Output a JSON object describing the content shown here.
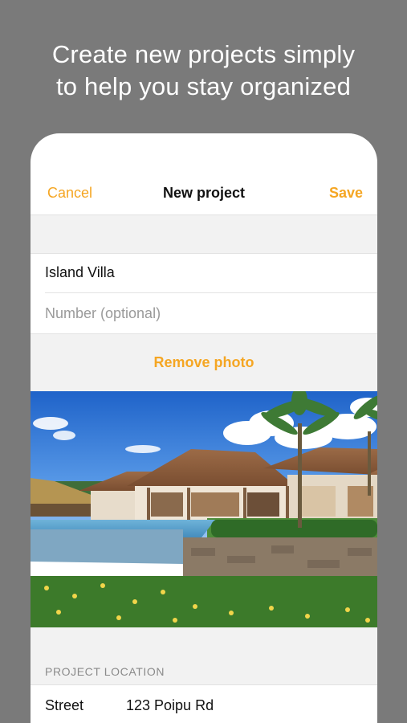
{
  "headline": {
    "line1": "Create new projects simply",
    "line2": "to help you stay organized"
  },
  "navbar": {
    "cancel_label": "Cancel",
    "title": "New project",
    "save_label": "Save"
  },
  "form": {
    "project_name_value": "Island Villa",
    "number_placeholder": "Number (optional)"
  },
  "photo": {
    "remove_label": "Remove photo"
  },
  "location": {
    "section_label": "PROJECT LOCATION",
    "street_label": "Street",
    "street_value": "123 Poipu Rd"
  },
  "colors": {
    "accent": "#f5a623",
    "background": "#7a7a7a",
    "section_bg": "#f2f2f2"
  }
}
